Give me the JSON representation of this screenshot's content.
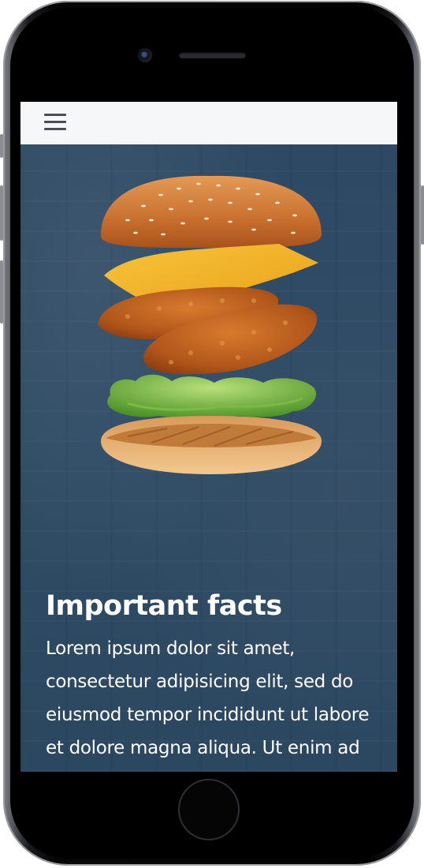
{
  "navbar": {
    "menu_icon": "hamburger-menu-icon"
  },
  "hero": {
    "image": "burger-ingredients-illustration",
    "title": "Important facts",
    "body": "Lorem ipsum dolor sit amet, consectetur adipisicing elit, sed do eiusmod tempor incididunt ut labore et dolore magna aliqua. Ut enim ad minim veniam, quis nostrud exercitation ullamco"
  },
  "colors": {
    "navbar_bg": "#f5f7f9",
    "hero_overlay": "#2d4963",
    "text": "#ffffff"
  }
}
